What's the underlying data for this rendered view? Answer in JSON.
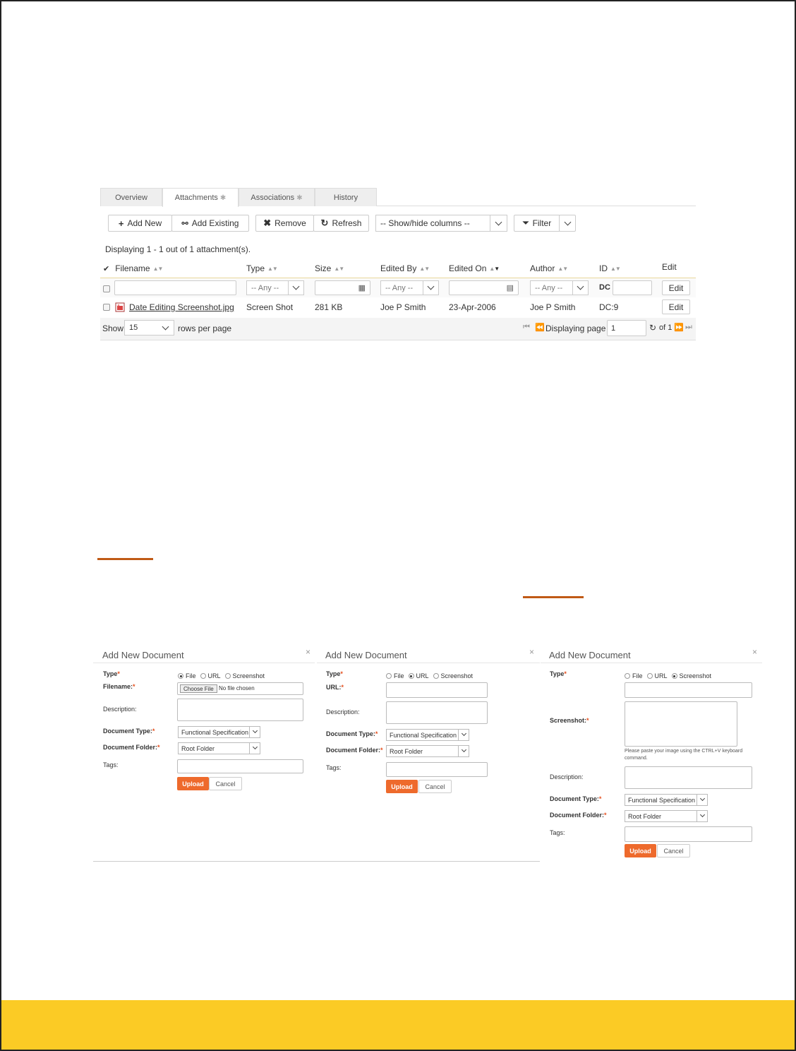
{
  "tabs": [
    {
      "label": "Overview"
    },
    {
      "label": "Attachments"
    },
    {
      "label": "Associations"
    },
    {
      "label": "History"
    }
  ],
  "toolbar": {
    "add_new": "Add New",
    "add_existing": "Add Existing",
    "remove": "Remove",
    "refresh": "Refresh",
    "show_hide": "-- Show/hide columns --",
    "filter": "Filter"
  },
  "status_text": "Displaying 1 - 1 out of 1 attachment(s).",
  "columns": [
    "Filename",
    "Type",
    "Size",
    "Edited By",
    "Edited On",
    "Author",
    "ID",
    "Edit"
  ],
  "filters": {
    "type": "-- Any --",
    "edited_by": "-- Any --",
    "author": "-- Any --",
    "id_prefix": "DC",
    "edit": "Edit"
  },
  "row": {
    "filename": "Date Editing Screenshot.jpg",
    "type": "Screen Shot",
    "size": "281 KB",
    "edited_by": "Joe P Smith",
    "edited_on": "23-Apr-2006",
    "author": "Joe P Smith",
    "id": "DC:9",
    "edit": "Edit"
  },
  "pager": {
    "show": "Show",
    "rows_per_page_value": "15",
    "rows_per_page": "rows per page",
    "displaying_page": "Displaying page",
    "page": "1",
    "of": "of 1"
  },
  "dialogs": [
    {
      "title": "Add New Document",
      "close": "×",
      "type_label": "Type",
      "options": [
        "File",
        "URL",
        "Screenshot"
      ],
      "selected": 0,
      "filename_label": "Filename:",
      "choose_file": "Choose File",
      "no_file": "No file chosen",
      "description_label": "Description:",
      "doc_type_label": "Document Type:",
      "doc_type_value": "Functional Specification",
      "folder_label": "Document Folder:",
      "folder_value": "Root Folder",
      "tags_label": "Tags:",
      "upload": "Upload",
      "cancel": "Cancel"
    },
    {
      "title": "Add New Document",
      "close": "×",
      "type_label": "Type",
      "options": [
        "File",
        "URL",
        "Screenshot"
      ],
      "selected": 1,
      "url_label": "URL:",
      "description_label": "Description:",
      "doc_type_label": "Document Type:",
      "doc_type_value": "Functional Specification",
      "folder_label": "Document Folder:",
      "folder_value": "Root Folder",
      "tags_label": "Tags:",
      "upload": "Upload",
      "cancel": "Cancel"
    },
    {
      "title": "Add New Document",
      "close": "×",
      "type_label": "Type",
      "options": [
        "File",
        "URL",
        "Screenshot"
      ],
      "selected": 2,
      "screenshot_label": "Screenshot:",
      "hint": "Please paste your image using the CTRL+V keyboard command.",
      "description_label": "Description:",
      "doc_type_label": "Document Type:",
      "doc_type_value": "Functional Specification",
      "folder_label": "Document Folder:",
      "folder_value": "Root Folder",
      "tags_label": "Tags:",
      "upload": "Upload",
      "cancel": "Cancel"
    }
  ],
  "colors": {
    "accent": "#ee6a2c",
    "footer": "#fbcb25",
    "rule": "#c05a16"
  }
}
